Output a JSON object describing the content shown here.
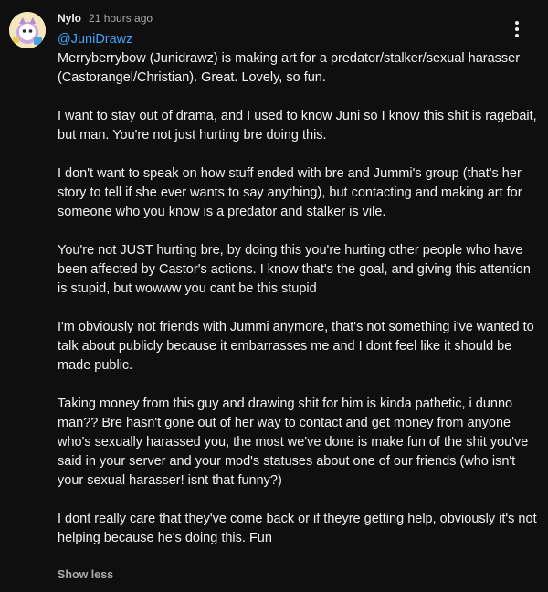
{
  "comment": {
    "author": "Nylo",
    "timestamp": "21 hours ago",
    "mention": "@JuniDrawz",
    "paragraphs": [
      "Merryberrybow (Junidrawz) is making art for a predator/stalker/sexual harasser (Castorangel/Christian). Great. Lovely, so fun.",
      "I want to stay out of drama, and I used to know Juni so I know this shit is ragebait, but man. You're not just hurting bre doing this.",
      "I don't want to speak on how stuff ended with bre and Jummi's group (that's her story to tell if she ever wants to say anything), but contacting and making art for someone who you know is a predator and stalker is vile.",
      "You're not JUST hurting bre, by doing this you're hurting other people who have been affected by Castor's actions. I know that's the goal, and giving this attention is stupid, but wowww you cant be this stupid",
      "I'm obviously not friends with Jummi anymore, that's not something i've wanted to talk about publicly because it embarrasses me and I dont feel like it should be made public.",
      "Taking money from this guy and drawing shit for him is kinda pathetic, i dunno man?? Bre hasn't gone out of her way to contact and get money from anyone who's sexually harassed you, the most we've done is make fun of the shit you've said in your server and your mod's statuses about one of our friends (who isn't your sexual harasser! isnt that funny?)",
      "I dont really care that they've come back or if theyre getting help, obviously it's not helping because he's doing this. Fun"
    ],
    "show_less_label": "Show less",
    "menu_icon": "more-vert-icon",
    "avatar_icon": "cartoon-avatar-icon"
  },
  "colors": {
    "background": "#0f0f0f",
    "text": "#f1f1f1",
    "secondary": "#aaaaaa",
    "link": "#3ea6ff"
  }
}
